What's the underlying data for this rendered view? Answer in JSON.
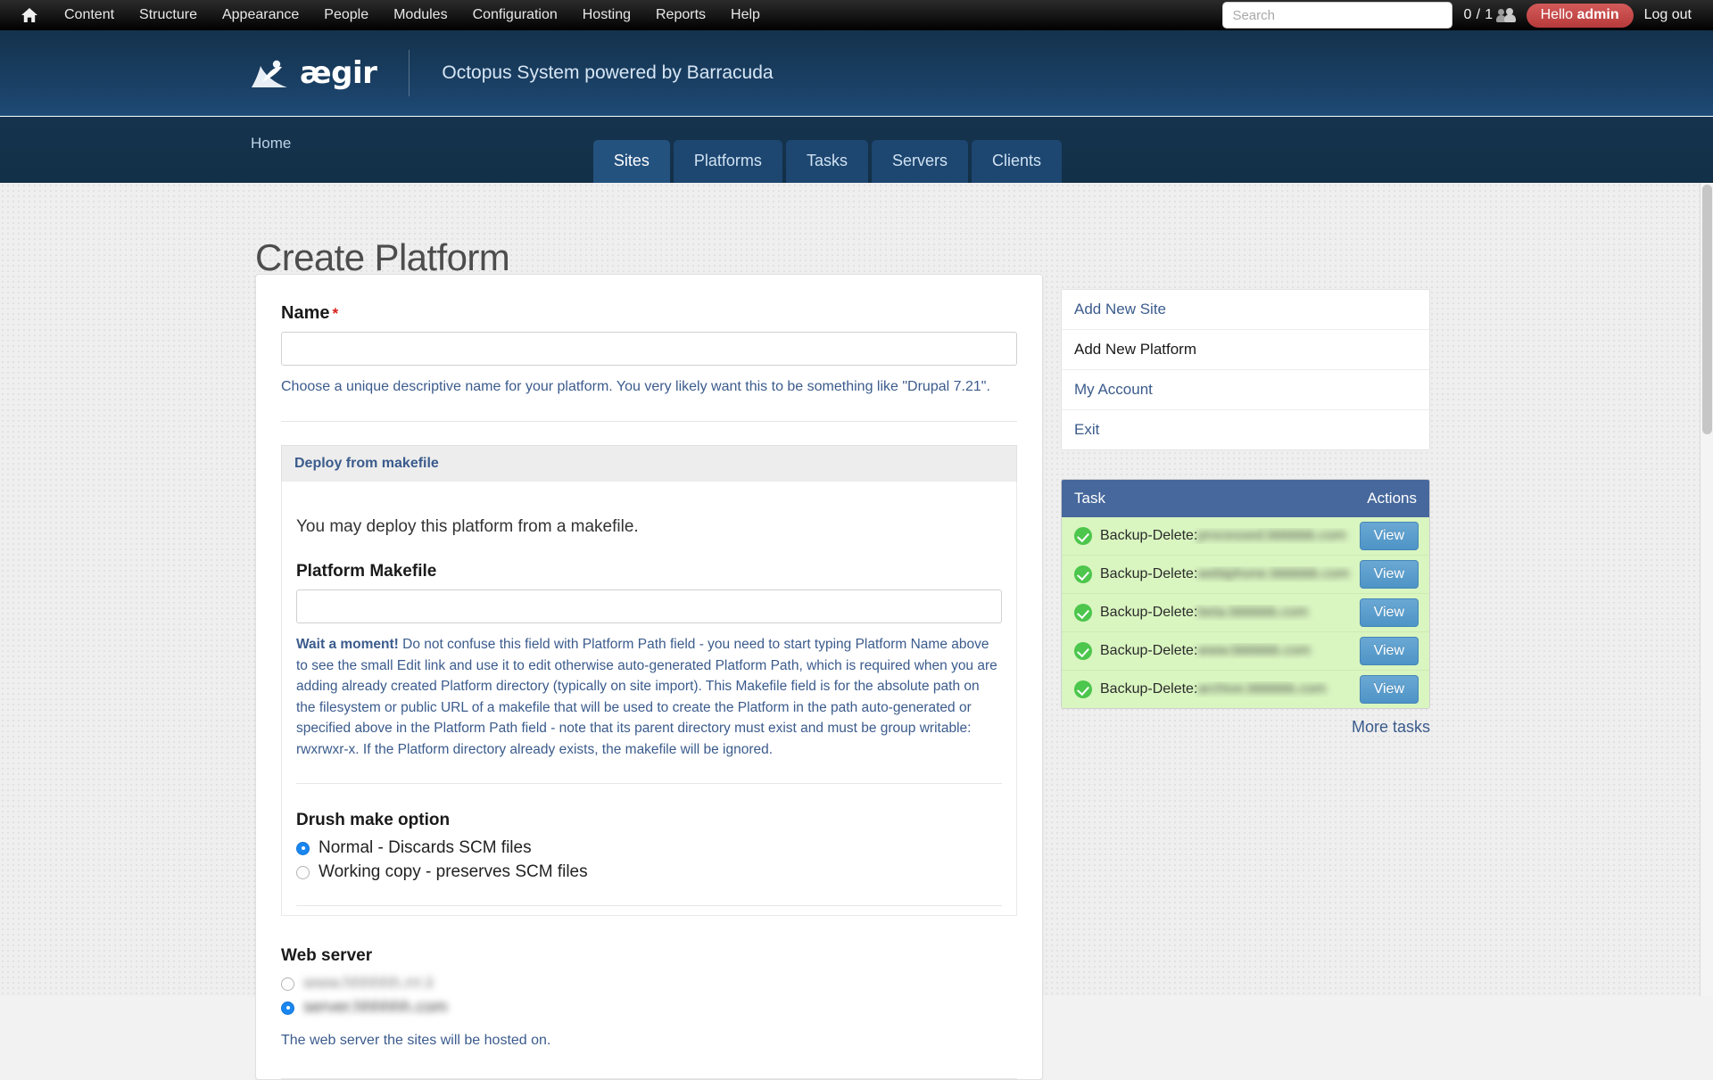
{
  "toolbar": {
    "home_icon": "home-icon",
    "menu": [
      {
        "label": "Content"
      },
      {
        "label": "Structure"
      },
      {
        "label": "Appearance"
      },
      {
        "label": "People"
      },
      {
        "label": "Modules"
      },
      {
        "label": "Configuration"
      },
      {
        "label": "Hosting"
      },
      {
        "label": "Reports"
      },
      {
        "label": "Help"
      }
    ],
    "search_placeholder": "Search",
    "search_value": "",
    "user_count": "0 / 1",
    "users_icon": "users-icon",
    "greeting_prefix": "Hello ",
    "greeting_user": "admin",
    "logout_label": "Log out"
  },
  "header": {
    "logo_icon": "aegir-wave-logo",
    "brand_name": "ægir",
    "tagline": "Octopus System powered by Barracuda"
  },
  "nav": {
    "breadcrumb": "Home",
    "tabs": [
      {
        "label": "Sites",
        "active": true
      },
      {
        "label": "Platforms",
        "active": false
      },
      {
        "label": "Tasks",
        "active": false
      },
      {
        "label": "Servers",
        "active": false
      },
      {
        "label": "Clients",
        "active": false
      }
    ]
  },
  "page": {
    "title": "Create Platform"
  },
  "form": {
    "name": {
      "label": "Name",
      "required_marker": "*",
      "value": "",
      "description": "Choose a unique descriptive name for your platform. You very likely want this to be something like \"Drupal 7.21\"."
    },
    "makefile_fieldset": {
      "legend": "Deploy from makefile",
      "intro": "You may deploy this platform from a makefile.",
      "field_label": "Platform Makefile",
      "field_value": "",
      "help_lead": "Wait a moment!",
      "help_text": " Do not confuse this field with Platform Path field - you need to start typing Platform Name above to see the small Edit link and use it to edit otherwise auto-generated Platform Path, which is required when you are adding already created Platform directory (typically on site import). This Makefile field is for the absolute path on the filesystem or public URL of a makefile that will be used to create the Platform in the path auto-generated or specified above in the Platform Path field - note that its parent directory must exist and must be group writable: rwxrwxr-x. If the Platform directory already exists, the makefile will be ignored."
    },
    "drush_make_option": {
      "label": "Drush make option",
      "options": [
        {
          "label": "Normal - Discards SCM files",
          "selected": true
        },
        {
          "label": "Working copy - preserves SCM files",
          "selected": false
        }
      ]
    },
    "web_server": {
      "label": "Web server",
      "options": [
        {
          "label": "www.hhhhhh.rrr.ii",
          "selected": false,
          "redacted": true
        },
        {
          "label": "server.hhhhhh.com",
          "selected": true,
          "redacted": true
        }
      ],
      "description": "The web server the sites will be hosted on."
    }
  },
  "sidebar": {
    "menu": [
      {
        "label": "Add New Site",
        "active": false
      },
      {
        "label": "Add New Platform",
        "active": true
      },
      {
        "label": "My Account",
        "active": false
      },
      {
        "label": "Exit",
        "active": false
      }
    ],
    "tasks_table": {
      "columns": {
        "task": "Task",
        "actions": "Actions"
      },
      "rows": [
        {
          "status_icon": "check-circle-icon",
          "name": "Backup-Delete:",
          "target": "processed.bbbbbb.com",
          "redacted": true,
          "action_label": "View"
        },
        {
          "status_icon": "check-circle-icon",
          "name": "Backup-Delete:",
          "target": "webiphone.bbbbbb.com",
          "redacted": true,
          "action_label": "View"
        },
        {
          "status_icon": "check-circle-icon",
          "name": "Backup-Delete:",
          "target": "beta.bbbbbb.com",
          "redacted": true,
          "action_label": "View"
        },
        {
          "status_icon": "check-circle-icon",
          "name": "Backup-Delete:",
          "target": "www.bbbbbb.com",
          "redacted": true,
          "action_label": "View"
        },
        {
          "status_icon": "check-circle-icon",
          "name": "Backup-Delete:",
          "target": "archive.bbbbbb.com",
          "redacted": true,
          "action_label": "View"
        }
      ],
      "more_label": "More tasks"
    }
  },
  "colors": {
    "toolbar_bg": "#151515",
    "header_navy": "#1b4167",
    "nav_navy": "#16334e",
    "tab_active": "#24527f",
    "link_blue": "#3b5b8c",
    "required_red": "#d91e18",
    "greeting_pill": "#b73a3a",
    "task_row_green": "#d9f5c0",
    "check_green": "#4cc64c",
    "view_button_blue": "#4e94c6",
    "table_header_blue": "#46689c",
    "radio_selected": "#1a86ef"
  }
}
